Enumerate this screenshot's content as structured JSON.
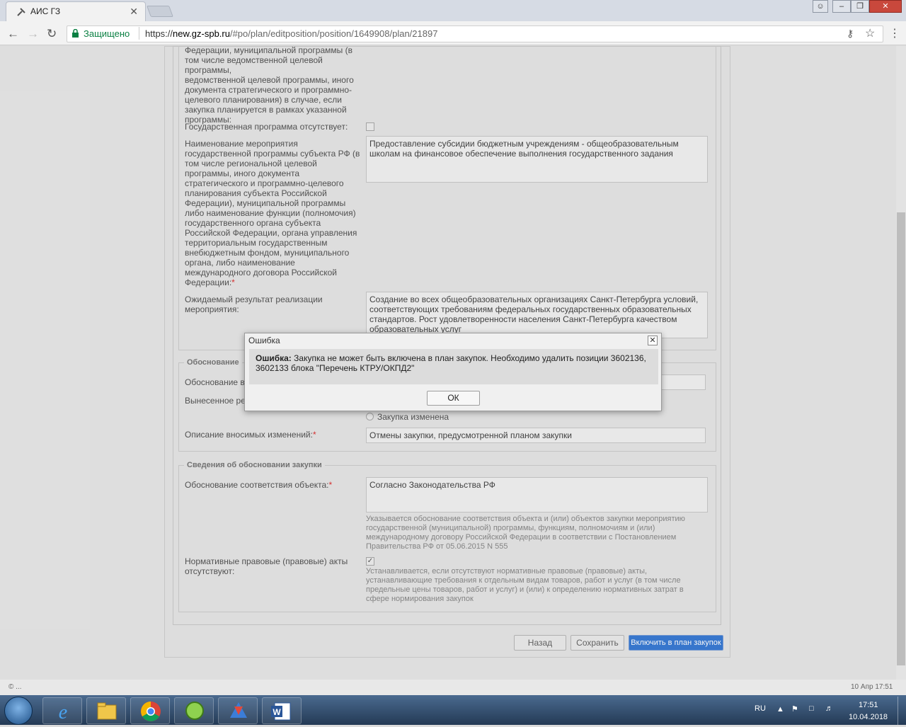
{
  "browser": {
    "tab_title": "АИС ГЗ",
    "security_label": "Защищено",
    "url_scheme": "https://",
    "url_host": "new.gz-spb.ru",
    "url_path": "/#po/plan/editposition/position/1649908/plan/21897"
  },
  "form": {
    "top_label_lines": [
      "Федерации, муниципальной программы (в",
      "том числе ведомственной целевой программы,",
      "ведомственной целевой программы, иного",
      "документа стратегического и программно-",
      "целевого планирования) в случае, если",
      "закупка планируется в рамках указанной",
      "программы:"
    ],
    "gov_program_absent_label": "Государственная программа отсутствует:",
    "event_name_label_lines": [
      "Наименование мероприятия",
      "государственной программы субъекта РФ (в",
      "том числе региональной целевой",
      "программы, иного документа",
      "стратегического и программно-целевого",
      "планирования субъекта Российской",
      "Федерации), муниципальной программы",
      "либо наименование функции (полномочия)",
      "государственного органа субъекта",
      "Российской Федерации, органа управления",
      "территориальным государственным",
      "внебюджетным фондом, муниципального",
      "органа, либо наименование",
      "международного договора Российской",
      "Федерации:"
    ],
    "event_name_value": "Предоставление субсидии бюджетным учреждениям - общеобразовательным школам на финансовое обеспечение выполнения государственного задания",
    "expected_result_label_lines": [
      "Ожидаемый результат реализации",
      "мероприятия:"
    ],
    "expected_result_value": "Создание во всех общеобразовательных организациях Санкт-Петербурга условий, соответствующих требованиям федеральных государственных образовательных стандартов. Рост удовлетворенности населения Санкт-Петербурга качеством образовательных услуг",
    "changes_legend": "Обоснование",
    "changes_reason_label": "Обоснование в",
    "changes_decision_label": "Вынесенное ре",
    "radio_changed_label": "Закупка изменена",
    "changes_desc_label": "Описание вносимых изменений:",
    "changes_desc_value": "Отмены закупки, предусмотренной планом закупки",
    "justification_legend": "Сведения об обосновании закупки",
    "object_justification_label": "Обоснование соответствия объекта:",
    "object_justification_value": "Согласно Законодательства РФ",
    "object_justification_hint": "Указывается обоснование соответствия объекта и (или) объектов закупки мероприятию государственной (муниципальной) программы, функциям, полномочиям и (или) международному договору Российской Федерации в соответствии с Постановлением Правительства РФ от 05.06.2015 N 555",
    "normative_absent_label_lines": [
      "Нормативные правовые (правовые) акты",
      "отсутствуют:"
    ],
    "normative_absent_hint": "Устанавливается, если отсутствуют нормативные правовые (правовые) акты, устанавливающие требования к отдельным видам товаров, работ и услуг (в том числе предельные цены товаров, работ и услуг) и (или) к определению нормативных затрат в сфере нормирования закупок",
    "required_mark": "*"
  },
  "buttons": {
    "back": "Назад",
    "save": "Сохранить",
    "include": "Включить в план закупок"
  },
  "dialog": {
    "title": "Ошибка",
    "close": "✕",
    "message_bold": "Ошибка:",
    "message": " Закупка не может быть включена в план закупок. Необходимо удалить позиции 3602136, 3602133 блока \"Перечень КТРУ/ОКПД2\"",
    "ok": "ОК"
  },
  "footer": {
    "left": "© ...",
    "right": "10 Апр 17:51"
  },
  "taskbar": {
    "lang": "RU",
    "time": "17:51",
    "date": "10.04.2018",
    "apps": [
      "ie-icon",
      "explorer-icon",
      "chrome-icon",
      "messenger-icon",
      "app-icon",
      "word-icon"
    ]
  }
}
